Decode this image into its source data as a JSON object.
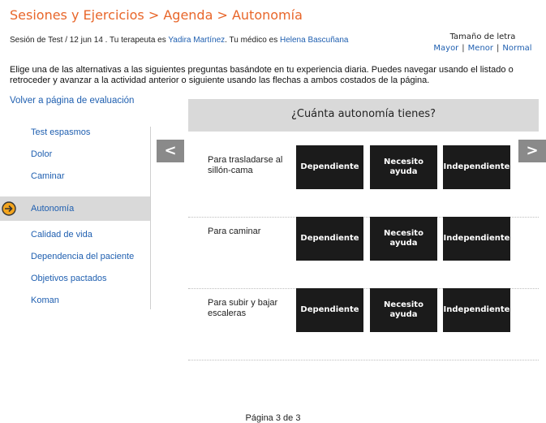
{
  "header": {
    "breadcrumb": "Sesiones y Ejercicios > Agenda > Autonomía",
    "session_prefix": "Sesión de Test / 12 jun 14 . Tu terapeuta es ",
    "therapist": "Yadira Martínez",
    "doctor_prefix": ". Tu médico es ",
    "doctor": "Helena Bascuñana"
  },
  "font_size": {
    "title": "Tamaño de letra",
    "bigger": "Mayor",
    "smaller": "Menor",
    "normal": "Normal"
  },
  "intro": "Elige una de las alternativas a las siguientes preguntas basándote en tu experiencia diaria. Puedes navegar usando el listado o retroceder y avanzar a la actividad anterior o siguiente usando las flechas a ambos costados de la página.",
  "back_link": "Volver a página de evaluación",
  "sidebar": {
    "items": [
      {
        "label": "Test espasmos"
      },
      {
        "label": "Dolor"
      },
      {
        "label": "Caminar"
      },
      {
        "label": "Autonomía",
        "active": true
      },
      {
        "label": "Calidad de vida"
      },
      {
        "label": "Dependencia del paciente"
      },
      {
        "label": "Objetivos pactados"
      },
      {
        "label": "Koman"
      }
    ]
  },
  "question": {
    "title": "¿Cuánta autonomía tienes?",
    "prev": "<",
    "next": ">",
    "rows": [
      {
        "label": "Para trasladarse al sillón-cama",
        "options": [
          "Dependiente",
          "Necesito ayuda",
          "Independiente"
        ]
      },
      {
        "label": "Para caminar",
        "options": [
          "Dependiente",
          "Necesito ayuda",
          "Independiente"
        ]
      },
      {
        "label": "Para subir y bajar escaleras",
        "options": [
          "Dependiente",
          "Necesito ayuda",
          "Independiente"
        ]
      }
    ]
  },
  "footer": {
    "page": "Página 3 de 3"
  },
  "colors": {
    "accent": "#e8662a",
    "link": "#1f5fb0",
    "button": "#1b1b1b",
    "panel": "#d9d9d9"
  }
}
